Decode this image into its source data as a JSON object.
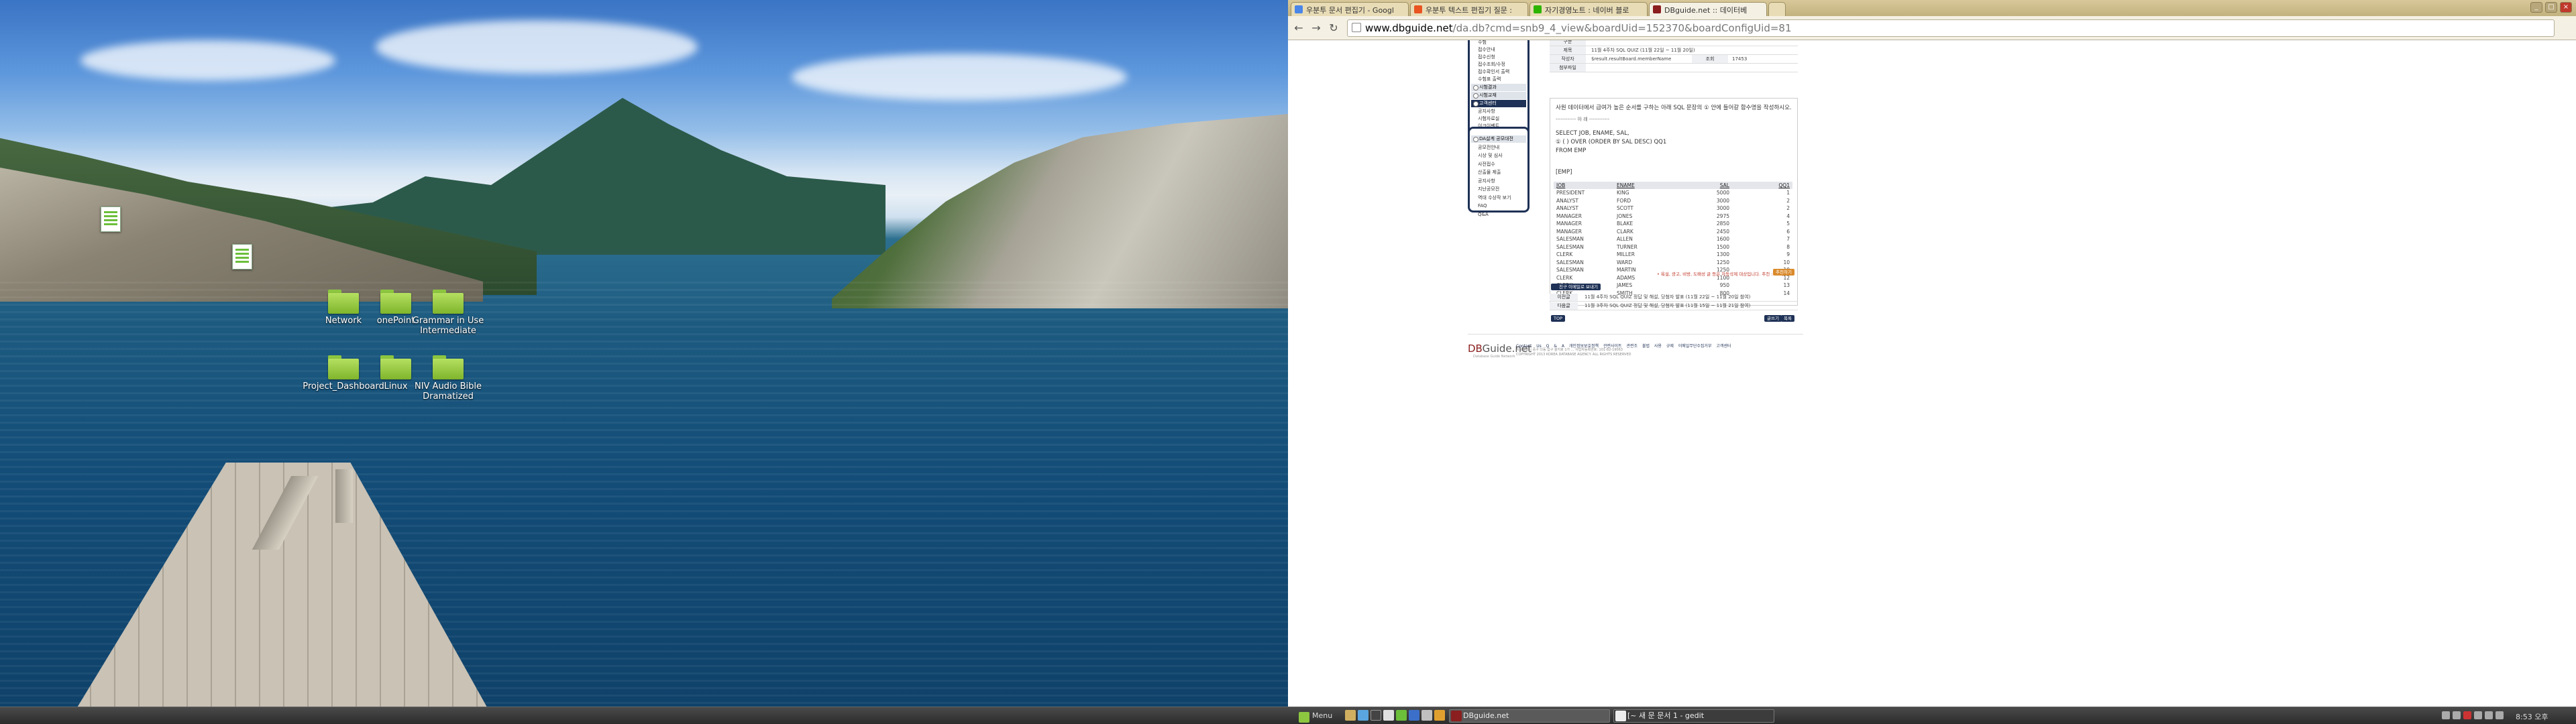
{
  "desktop": {
    "icons": [
      {
        "label": "Network"
      },
      {
        "label": "onePoint"
      },
      {
        "label": "Grammar in Use Intermediate"
      },
      {
        "label": "Project_Dashboard"
      },
      {
        "label": "Linux"
      },
      {
        "label": "NIV Audio Bible Dramatized"
      }
    ]
  },
  "browser": {
    "tabs": [
      {
        "label": "우분투 문서 편집기 - Googl"
      },
      {
        "label": "우분투 텍스트 편집기 질문 :"
      },
      {
        "label": "자기경영노트 : 네이버 블로"
      },
      {
        "label": "DBguide.net :: 데이터베"
      }
    ],
    "url_host": "www.dbguide.net",
    "url_path": "/da.db?cmd=snb9_4_view&boardUid=152370&boardConfigUid=81"
  },
  "sidebar1": {
    "items": [
      {
        "label": "수험",
        "head": false
      },
      {
        "label": "접수안내",
        "head": false
      },
      {
        "label": "접수신청",
        "head": false
      },
      {
        "label": "접수조회/수정",
        "head": false
      },
      {
        "label": "접수확인서 출력",
        "head": false
      },
      {
        "label": "수험표 출력",
        "head": false
      },
      {
        "label": "시험결과",
        "head": true
      },
      {
        "label": "시험교재",
        "head": true
      },
      {
        "label": "고객센터",
        "head": true,
        "active": true
      },
      {
        "label": "공지사항",
        "head": false
      },
      {
        "label": "시험자료실",
        "head": false
      },
      {
        "label": "이크이벤트",
        "head": false
      },
      {
        "label": "FAQ",
        "head": false
      },
      {
        "label": "Q&A",
        "head": false
      }
    ]
  },
  "sidebar2": {
    "title": "DA설계 공모대전",
    "items": [
      {
        "label": "공모전안내"
      },
      {
        "label": "시상 및 심사"
      },
      {
        "label": "사전접수"
      },
      {
        "label": "산출물 제출"
      },
      {
        "label": "공지사항"
      },
      {
        "label": "지난공모전"
      },
      {
        "label": "역대 수상작 보기"
      },
      {
        "label": "FAQ"
      },
      {
        "label": "Q&A"
      }
    ]
  },
  "post": {
    "label_category": "구분",
    "label_title": "제목",
    "title": "11월 4주차 SQL QUIZ (11월 22일 ~ 11월 20일)",
    "label_author": "작성자",
    "author": "$result.resultBoard.memberName",
    "label_views": "조회",
    "views": "17453",
    "label_attach": "첨부파일",
    "question": "사원 데이터에서 급여가 높은 순서를 구하는 아래 SQL 문장의 ① 안에 들어갈 함수명을 작성하시오.",
    "divider": "------------ 아          래 ------------",
    "sql1": "SELECT JOB, ENAME, SAL,",
    "sql2": "  ① ( ) OVER (ORDER BY SAL DESC) QQ1",
    "sql3": "FROM EMP",
    "table_name": "[EMP]",
    "columns": [
      "JOB",
      "ENAME",
      "SAL",
      "QQ1"
    ],
    "rows": [
      [
        "PRESIDENT",
        "KING",
        "5000",
        "1"
      ],
      [
        "ANALYST",
        "FORD",
        "3000",
        "2"
      ],
      [
        "ANALYST",
        "SCOTT",
        "3000",
        "2"
      ],
      [
        "MANAGER",
        "JONES",
        "2975",
        "4"
      ],
      [
        "MANAGER",
        "BLAKE",
        "2850",
        "5"
      ],
      [
        "MANAGER",
        "CLARK",
        "2450",
        "6"
      ],
      [
        "SALESMAN",
        "ALLEN",
        "1600",
        "7"
      ],
      [
        "SALESMAN",
        "TURNER",
        "1500",
        "8"
      ],
      [
        "CLERK",
        "MILLER",
        "1300",
        "9"
      ],
      [
        "SALESMAN",
        "WARD",
        "1250",
        "10"
      ],
      [
        "SALESMAN",
        "MARTIN",
        "1250",
        "10"
      ],
      [
        "CLERK",
        "ADAMS",
        "1100",
        "12"
      ],
      [
        "CLERK",
        "JAMES",
        "950",
        "13"
      ],
      [
        "CLERK",
        "SMITH",
        "800",
        "14"
      ]
    ],
    "notice": "• 욕설, 광고, 비방, 도배성 글 등은 자동삭제 대상입니다. 추천 : 56회",
    "recommend": "추천하기",
    "friend_btn": "친구 이메일로 보내기",
    "prev_label": "이전글",
    "prev_text": "11월 4주차 SQL QUIZ 정답 및 해설, 당첨자 발표 (11월 22일 ~ 11월 20일 참여)",
    "next_label": "다음글",
    "next_text": "11월 3주차 SQL QUIZ 정답 및 해설, 당첨자 발표 (11월 15일 ~ 11월 21일 참여)",
    "top_btn": "TOP",
    "write_btn": "글쓰기",
    "list_btn": "목록"
  },
  "footer": {
    "logo_db": "DB",
    "logo_rest": "Guide.net",
    "logo_sub": "Database Guide Network",
    "links": "Contact Us   Q & A   개인정보보호정책   관련사이트   관련조 불법 사용 규제   이메일무단수집거부   고객센터",
    "addr1": "서울특별시 중구 다동 입구 을지로 1가 ...   사업자등록번호: 101-82-19063",
    "addr2": "COPYRIGHT 2013 KOREA DATABASE AGENCY. ALL RIGHTS RESERVED"
  },
  "taskbar": {
    "menu": "Menu",
    "window1": "DBguide.net",
    "window2": "[~ 새 문 문서 1 - gedit",
    "clock": "8:53 오후"
  }
}
